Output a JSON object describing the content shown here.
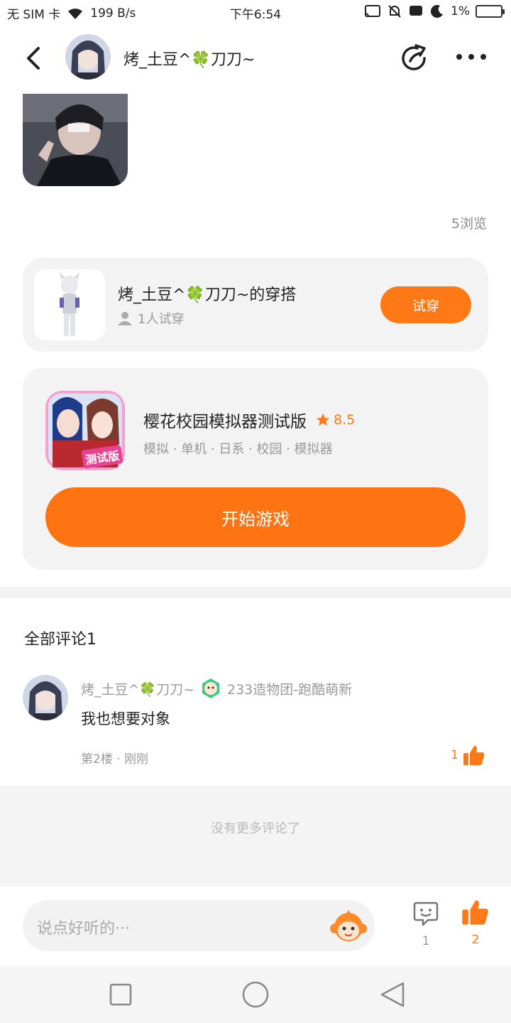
{
  "status_bar": {
    "sim": "无 SIM 卡",
    "speed": "199 B/s",
    "time": "下午6:54",
    "battery": "1%"
  },
  "header": {
    "user_name": "烤_土豆^🍀刀刀~",
    "back_icon": "chevron-left-icon",
    "share_icon": "share-icon",
    "more_icon": "more-dots-icon"
  },
  "post": {
    "views": "5浏览"
  },
  "outfit": {
    "title": "烤_土豆^🍀刀刀~的穿搭",
    "tryon_count": "1人试穿",
    "tryon_button": "试穿"
  },
  "game": {
    "title": "樱花校园模拟器测试版",
    "rating": "8.5",
    "tags": "模拟 · 单机 · 日系 · 校园 · 模拟器",
    "start_button": "开始游戏",
    "icon_badge": "测试版"
  },
  "comments": {
    "title": "全部评论1",
    "items": [
      {
        "author": "烤_土豆^🍀刀刀~",
        "badge": "233造物团-跑酷萌新",
        "text": "我也想要对象",
        "floor_time": "第2楼 · 刚刚",
        "likes": "1"
      }
    ],
    "no_more": "没有更多评论了"
  },
  "input_bar": {
    "placeholder": "说点好听的···",
    "comment_count": "1",
    "like_count": "2"
  },
  "colors": {
    "accent": "#ff7a17",
    "card_bg": "#f3f3f3"
  }
}
